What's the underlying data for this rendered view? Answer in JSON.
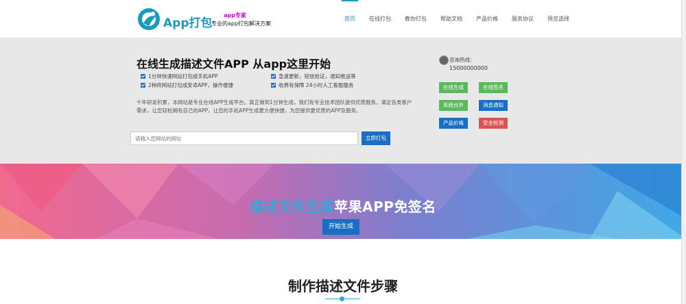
{
  "header": {
    "brand": "App打包",
    "tagline_top": "app专家",
    "tagline_bottom": "专业的app打包解决方案",
    "nav": [
      "首页",
      "在线打包",
      "教你打包",
      "帮助文档",
      "产品价格",
      "服务协议",
      "预览选择"
    ]
  },
  "hero": {
    "title": "在线生成描述文件APP 从app这里开始",
    "features": [
      "1分钟快速网站打包成手机APP",
      "2种终网站打包成安卓APP，操作便捷",
      "急速更新，短信验证，通知推送等",
      "收费有保障 24小时人工客服服务"
    ],
    "description": "十年研发积累，本网站是专业在线APP生成平台。真正做到1分钟生成，我们有专业技术团队提供优质服务，满足各类客户需求，让您轻松拥有自己的APP，让您的手机APP生成更方便快捷，为您提供更优质的APP及服务。",
    "url_placeholder": "请输入您网站的网址",
    "url_button": "立即打包",
    "contact_label": "咨询热线:",
    "contact_phone": "15000000000",
    "side_buttons": [
      {
        "label": "在线生成",
        "color": "#5cb85c"
      },
      {
        "label": "在线签名",
        "color": "#5cb85c"
      },
      {
        "label": "系统合并",
        "color": "#5cb85c"
      },
      {
        "label": "消息通知",
        "color": "#1a6fc4"
      },
      {
        "label": "产品价格",
        "color": "#1a6fc4"
      },
      {
        "label": "安全检测",
        "color": "#d9534f"
      }
    ]
  },
  "banner": {
    "title_part1": "描述文件生成",
    "title_part2": "苹果APP免签名",
    "button": "开始生成"
  },
  "steps": {
    "title": "制作描述文件步骤"
  }
}
